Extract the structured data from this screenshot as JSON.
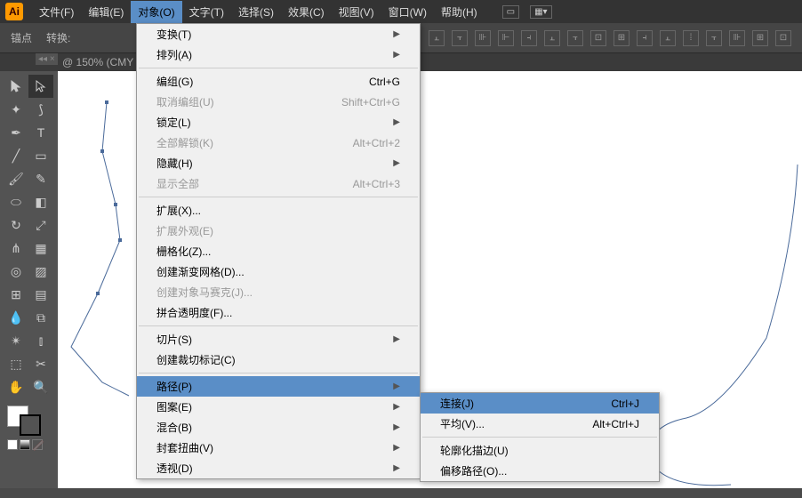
{
  "app": {
    "icon_label": "Ai"
  },
  "menubar": [
    {
      "label": "文件(F)"
    },
    {
      "label": "编辑(E)"
    },
    {
      "label": "对象(O)",
      "active": true
    },
    {
      "label": "文字(T)"
    },
    {
      "label": "选择(S)"
    },
    {
      "label": "效果(C)"
    },
    {
      "label": "视图(V)"
    },
    {
      "label": "窗口(W)"
    },
    {
      "label": "帮助(H)"
    }
  ],
  "control_bar": {
    "anchor": "锚点",
    "convert": "转换:"
  },
  "tab_title": "@ 150% (CMY",
  "dropdown": [
    {
      "label": "变换(T)",
      "submenu": true
    },
    {
      "label": "排列(A)",
      "submenu": true
    },
    {
      "sep": true
    },
    {
      "label": "编组(G)",
      "shortcut": "Ctrl+G"
    },
    {
      "label": "取消编组(U)",
      "shortcut": "Shift+Ctrl+G",
      "disabled": true
    },
    {
      "label": "锁定(L)",
      "submenu": true
    },
    {
      "label": "全部解锁(K)",
      "shortcut": "Alt+Ctrl+2",
      "disabled": true
    },
    {
      "label": "隐藏(H)",
      "submenu": true
    },
    {
      "label": "显示全部",
      "shortcut": "Alt+Ctrl+3",
      "disabled": true
    },
    {
      "sep": true
    },
    {
      "label": "扩展(X)..."
    },
    {
      "label": "扩展外观(E)",
      "disabled": true
    },
    {
      "label": "栅格化(Z)..."
    },
    {
      "label": "创建渐变网格(D)..."
    },
    {
      "label": "创建对象马赛克(J)...",
      "disabled": true
    },
    {
      "label": "拼合透明度(F)..."
    },
    {
      "sep": true
    },
    {
      "label": "切片(S)",
      "submenu": true
    },
    {
      "label": "创建裁切标记(C)"
    },
    {
      "sep": true
    },
    {
      "label": "路径(P)",
      "submenu": true,
      "hl": true
    },
    {
      "label": "图案(E)",
      "submenu": true
    },
    {
      "label": "混合(B)",
      "submenu": true
    },
    {
      "label": "封套扭曲(V)",
      "submenu": true
    },
    {
      "label": "透视(D)",
      "submenu": true
    }
  ],
  "submenu": [
    {
      "label": "连接(J)",
      "shortcut": "Ctrl+J",
      "hl": true
    },
    {
      "label": "平均(V)...",
      "shortcut": "Alt+Ctrl+J"
    },
    {
      "sep": true
    },
    {
      "label": "轮廓化描边(U)"
    },
    {
      "label": "偏移路径(O)..."
    }
  ],
  "chart_data": null
}
